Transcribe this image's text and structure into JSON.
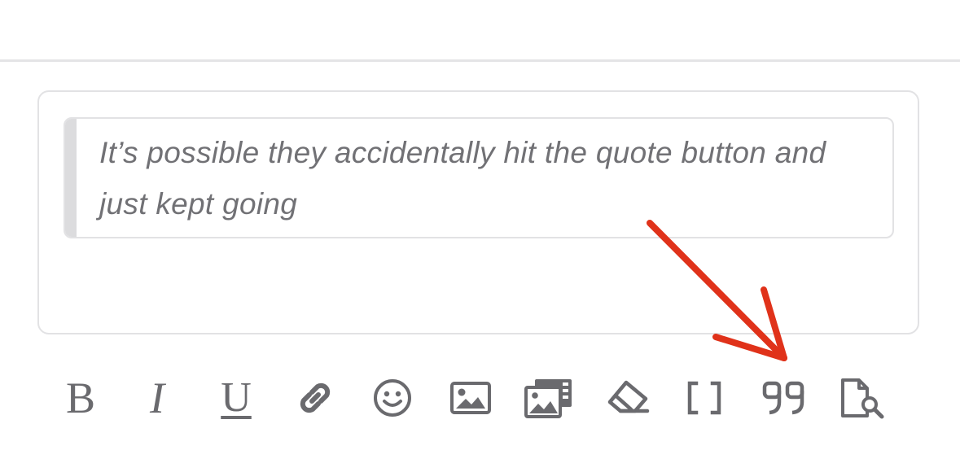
{
  "editor": {
    "quote_text": "It’s possible they accidentally hit the quote button and just kept going"
  },
  "toolbar": {
    "items": [
      {
        "name": "bold",
        "glyph": "B"
      },
      {
        "name": "italic",
        "glyph": "I"
      },
      {
        "name": "underline",
        "glyph": "U"
      },
      {
        "name": "link",
        "icon": "link-icon"
      },
      {
        "name": "emoji",
        "icon": "smiley-icon"
      },
      {
        "name": "image",
        "icon": "image-icon"
      },
      {
        "name": "media-gallery",
        "icon": "gallery-icon"
      },
      {
        "name": "remove-formatting",
        "icon": "eraser-icon"
      },
      {
        "name": "bbcode",
        "glyph": "[ ]"
      },
      {
        "name": "quote",
        "icon": "quote-icon"
      },
      {
        "name": "preview",
        "icon": "preview-icon"
      }
    ],
    "icon_color": "#6a6a6e"
  },
  "annotation": {
    "arrow_color": "#e0321a",
    "points_to": "quote"
  }
}
